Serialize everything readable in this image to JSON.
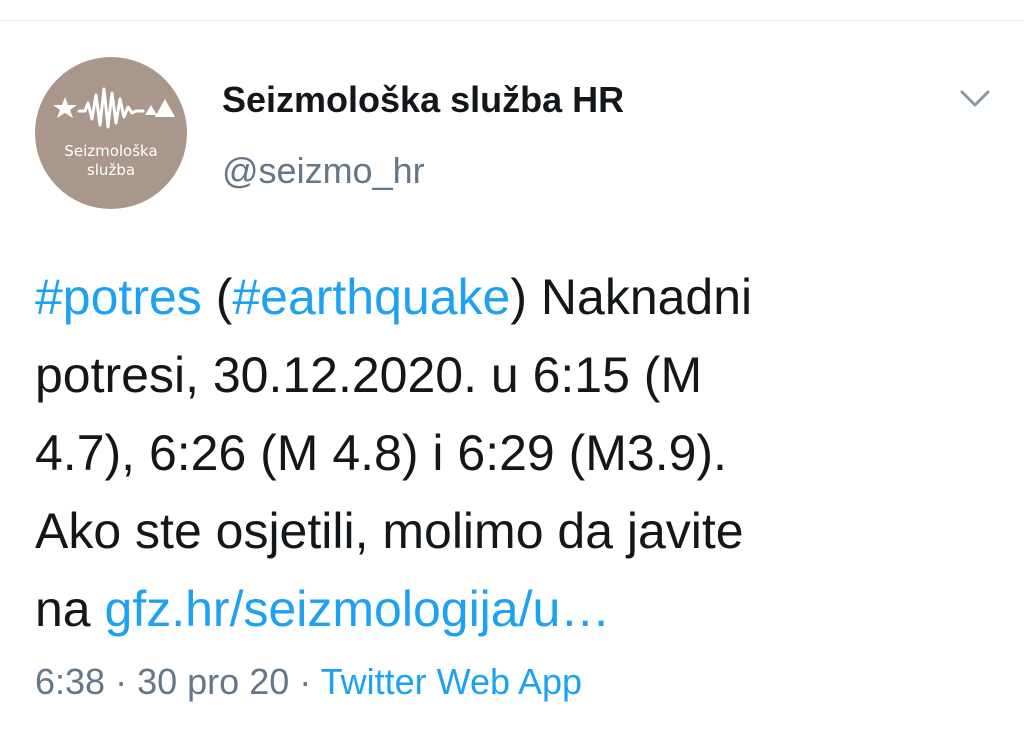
{
  "avatar": {
    "background_color": "#a8978a",
    "line1": "Seizmološka",
    "line2": "služba"
  },
  "user": {
    "display_name": "Seizmološka služba HR",
    "handle": "@seizmo_hr"
  },
  "tweet": {
    "hashtag_1": "#potres",
    "open_paren": "(",
    "hashtag_2": "#earthquake",
    "close_paren_text": ") Naknadni",
    "line_2": "potresi, 30.12.2020. u 6:15 (M",
    "line_3": "4.7), 6:26 (M 4.8) i 6:29 (M3.9).",
    "line_4": "Ako ste osjetili, molimo da javite",
    "line_5_prefix": "na",
    "link": "gfz.hr/seizmologija/u…"
  },
  "meta": {
    "time": "6:38",
    "sep_1": "·",
    "date": "30 pro 20",
    "sep_2": "·",
    "source": "Twitter Web App"
  },
  "colors": {
    "link": "#1da1f2",
    "text": "#14171a",
    "secondary": "#657786"
  },
  "icons": {
    "menu": "chevron-down-icon"
  }
}
